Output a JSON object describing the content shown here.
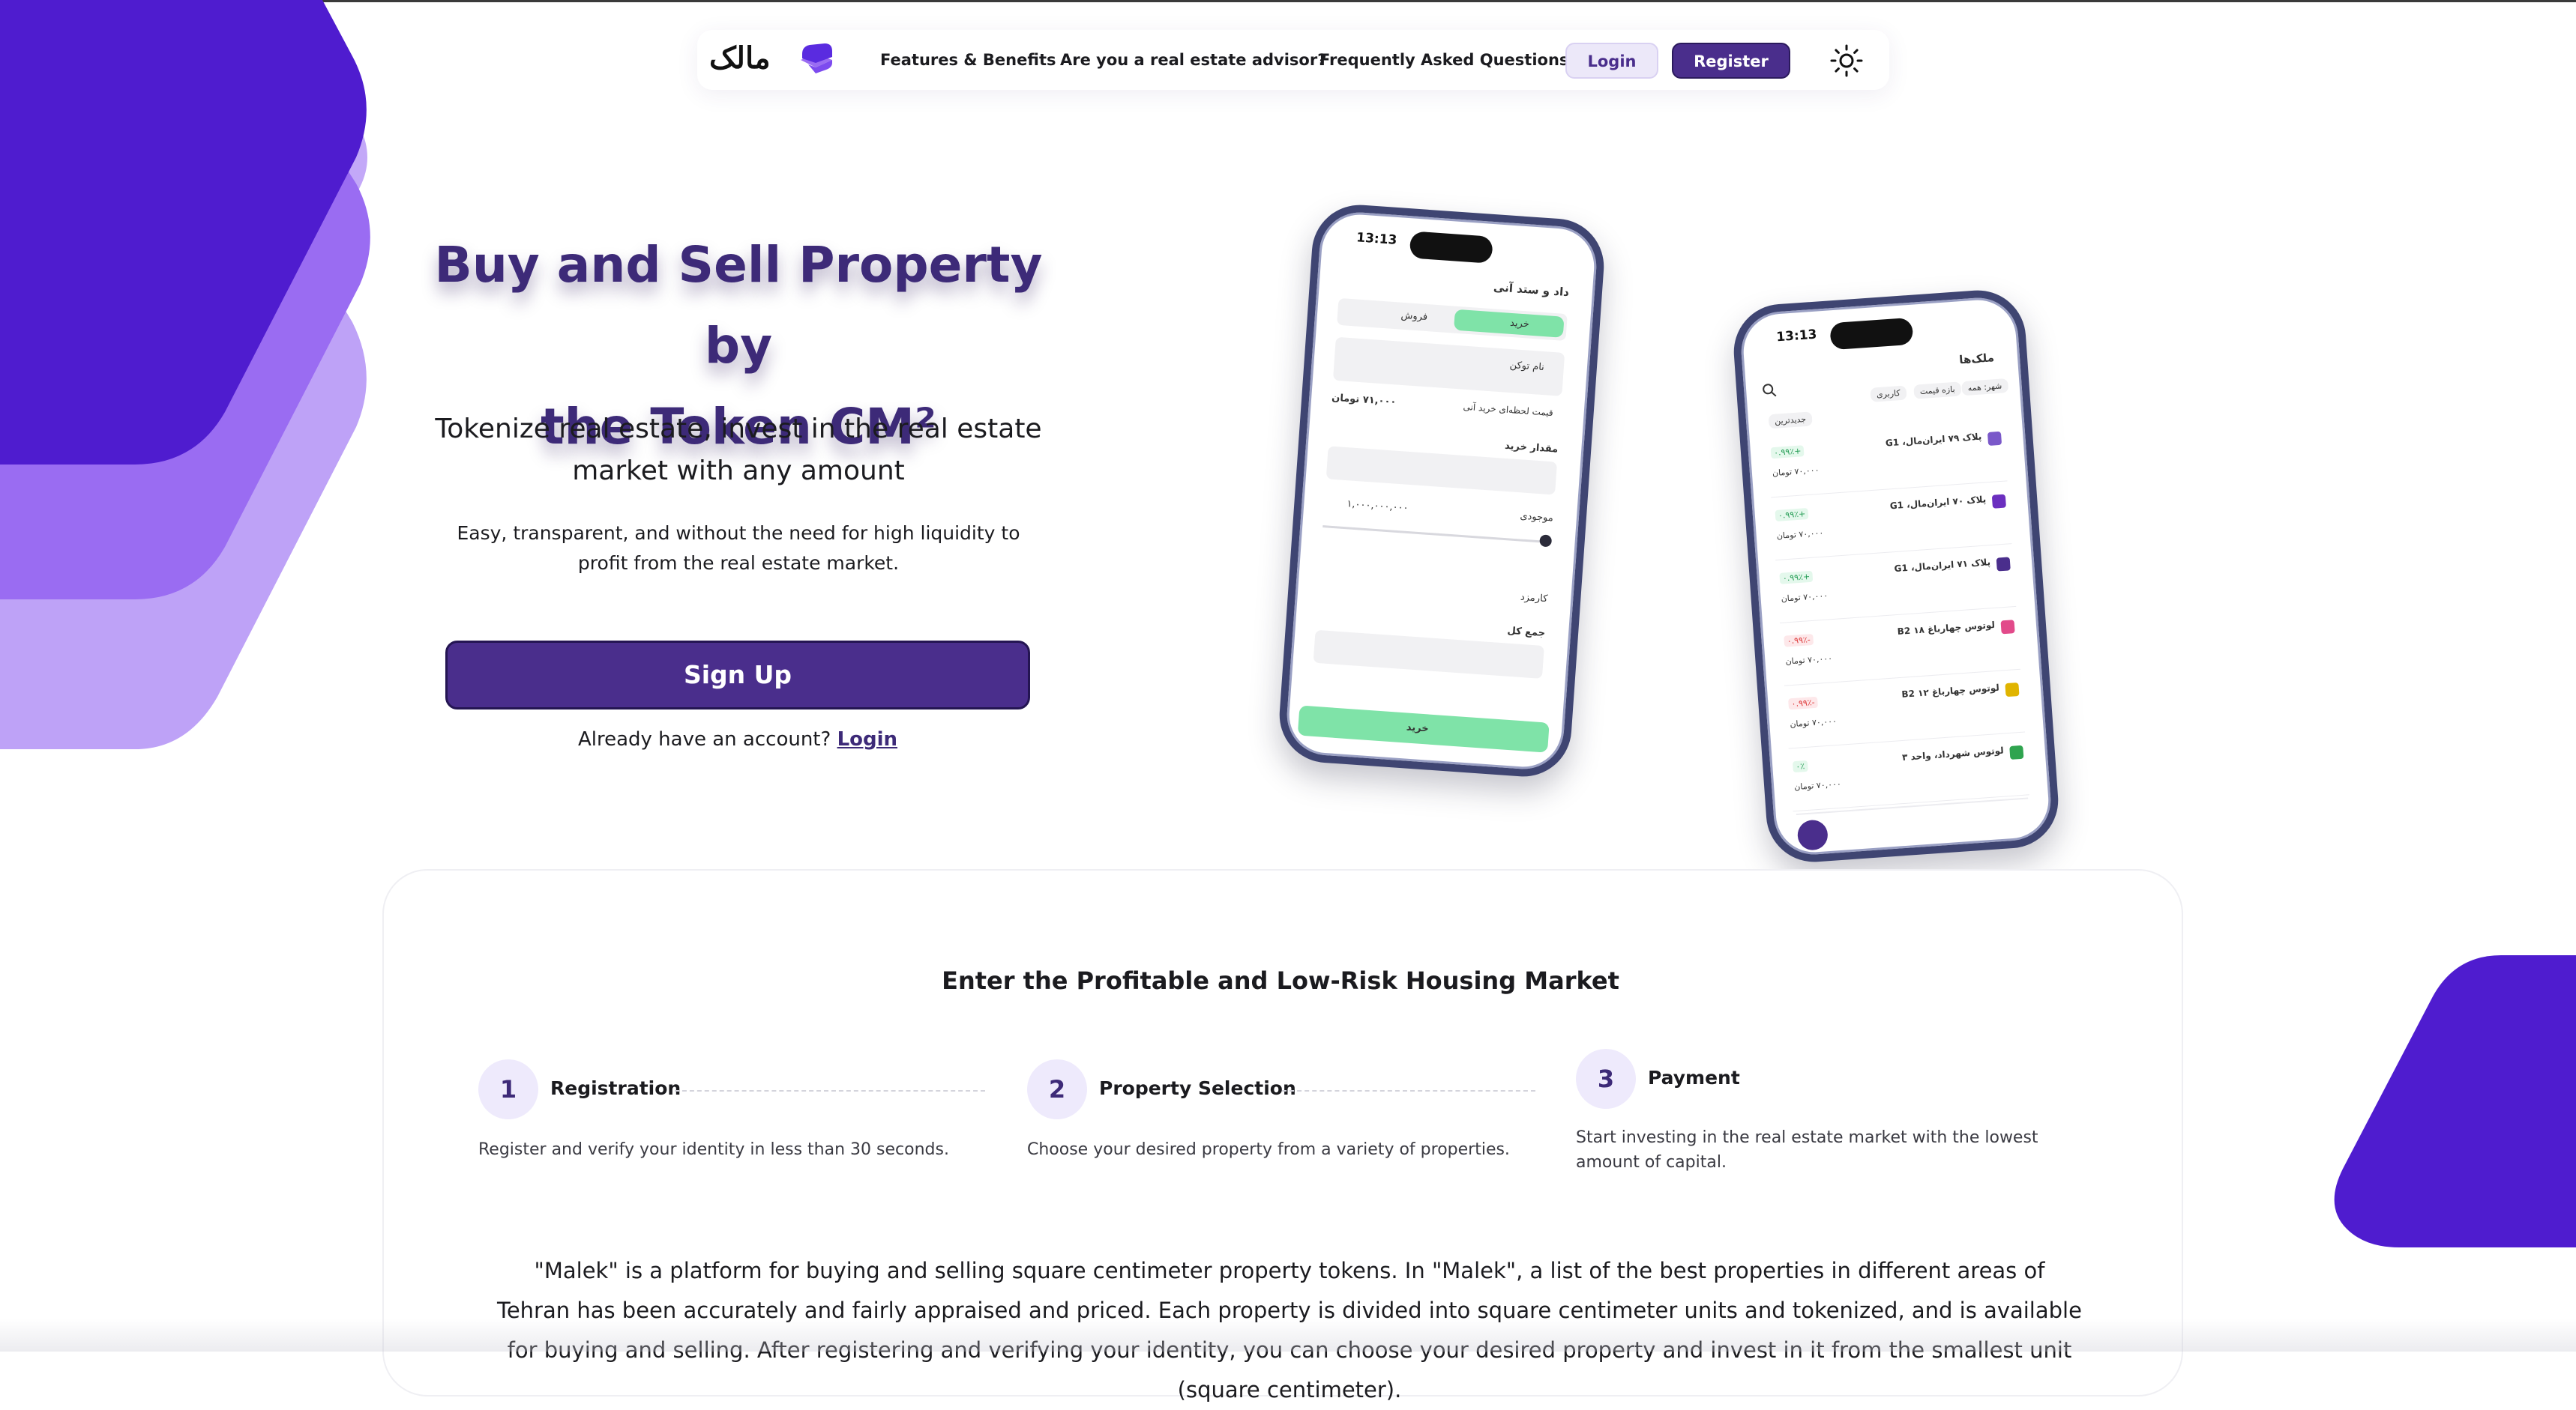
{
  "brand": {
    "logo_text": "مالک",
    "logo_icon": "layers-icon"
  },
  "nav": {
    "links": [
      "Features & Benefits",
      "Are you a real estate advisor?",
      "Frequently Asked Questions"
    ],
    "login_label": "Login",
    "register_label": "Register",
    "theme_icon": "sun-icon"
  },
  "hero": {
    "title_line1": "Buy and Sell Property by",
    "title_line2": "the Token CM²",
    "subtitle": "Tokenize real estate, invest in the real estate market with any amount",
    "description": "Easy, transparent, and without the need for high liquidity to profit from the real estate market.",
    "signup_label": "Sign Up",
    "have_account_text": "Already have an account?",
    "login_link": "Login"
  },
  "phone_left": {
    "time": "13:13",
    "header": "داد و ستد آنی",
    "tab_buy": "خرید",
    "tab_sell": "فروش",
    "token_name": "نام توکن",
    "price_label": "قیمت لحظه‌ای خرید آنی",
    "price_value": "۷۱,۰۰۰ تومان",
    "amount_label": "مقدار خرید",
    "balance_label": "موجودی",
    "balance_value": "۱,۰۰۰,۰۰۰,۰۰۰",
    "fee_label": "کارمزد",
    "total_label": "جمع کل",
    "buy_button": "خرید"
  },
  "phone_right": {
    "time": "13:13",
    "header": "ملک‌ها",
    "filters": [
      "شهر: همه",
      "بازه قیمت",
      "کاربری",
      "جدیدترین"
    ],
    "listings": [
      {
        "name": "پلاک ۷۹ ایران‌مال، G1",
        "change": "+۰.۹۹٪",
        "price": "۷۰,۰۰۰ تومان"
      },
      {
        "name": "پلاک ۷۰ ایران‌مال، G1",
        "change": "+۰.۹۹٪",
        "price": "۷۰,۰۰۰ تومان"
      },
      {
        "name": "پلاک ۷۱ ایران‌مال، G1",
        "change": "+۰.۹۹٪",
        "price": "۷۰,۰۰۰ تومان"
      },
      {
        "name": "لوتوس چهارباغ B2 ۱۸",
        "change": "-۰.۹۹٪",
        "price": "۷۰,۰۰۰ تومان"
      },
      {
        "name": "لوتوس چهارباغ B2 ۱۲",
        "change": "-۰.۹۹٪",
        "price": "۷۰,۰۰۰ تومان"
      },
      {
        "name": "لوتوس شهرداد، واحد ۳",
        "change": "۰٪",
        "price": "۷۰,۰۰۰ تومان"
      }
    ]
  },
  "section": {
    "title": "Enter the Profitable and Low-Risk Housing Market",
    "steps": [
      {
        "number": "1",
        "title": "Registration",
        "desc": "Register and verify your identity in less than 30 seconds."
      },
      {
        "number": "2",
        "title": "Property Selection",
        "desc": "Choose your desired property from a variety of properties."
      },
      {
        "number": "3",
        "title": "Payment",
        "desc": "Start investing in the real estate market with the lowest amount of capital."
      }
    ],
    "about": "\"Malek\" is a platform for buying and selling square centimeter property tokens. In \"Malek\", a list of the best properties in different areas of Tehran has been accurately and fairly appraised and priced. Each property is divided into square centimeter units and tokenized, and is available for buying and selling. After registering and verifying your identity, you can choose your desired property and invest in it from the smallest unit (square centimeter)."
  },
  "colors": {
    "brand_purple": "#4a2e8c",
    "deco_dark": "#4f1ccf",
    "deco_mid": "#9a6cf2",
    "deco_light": "#bfa3f7",
    "buy_green": "#7fe3a8"
  }
}
